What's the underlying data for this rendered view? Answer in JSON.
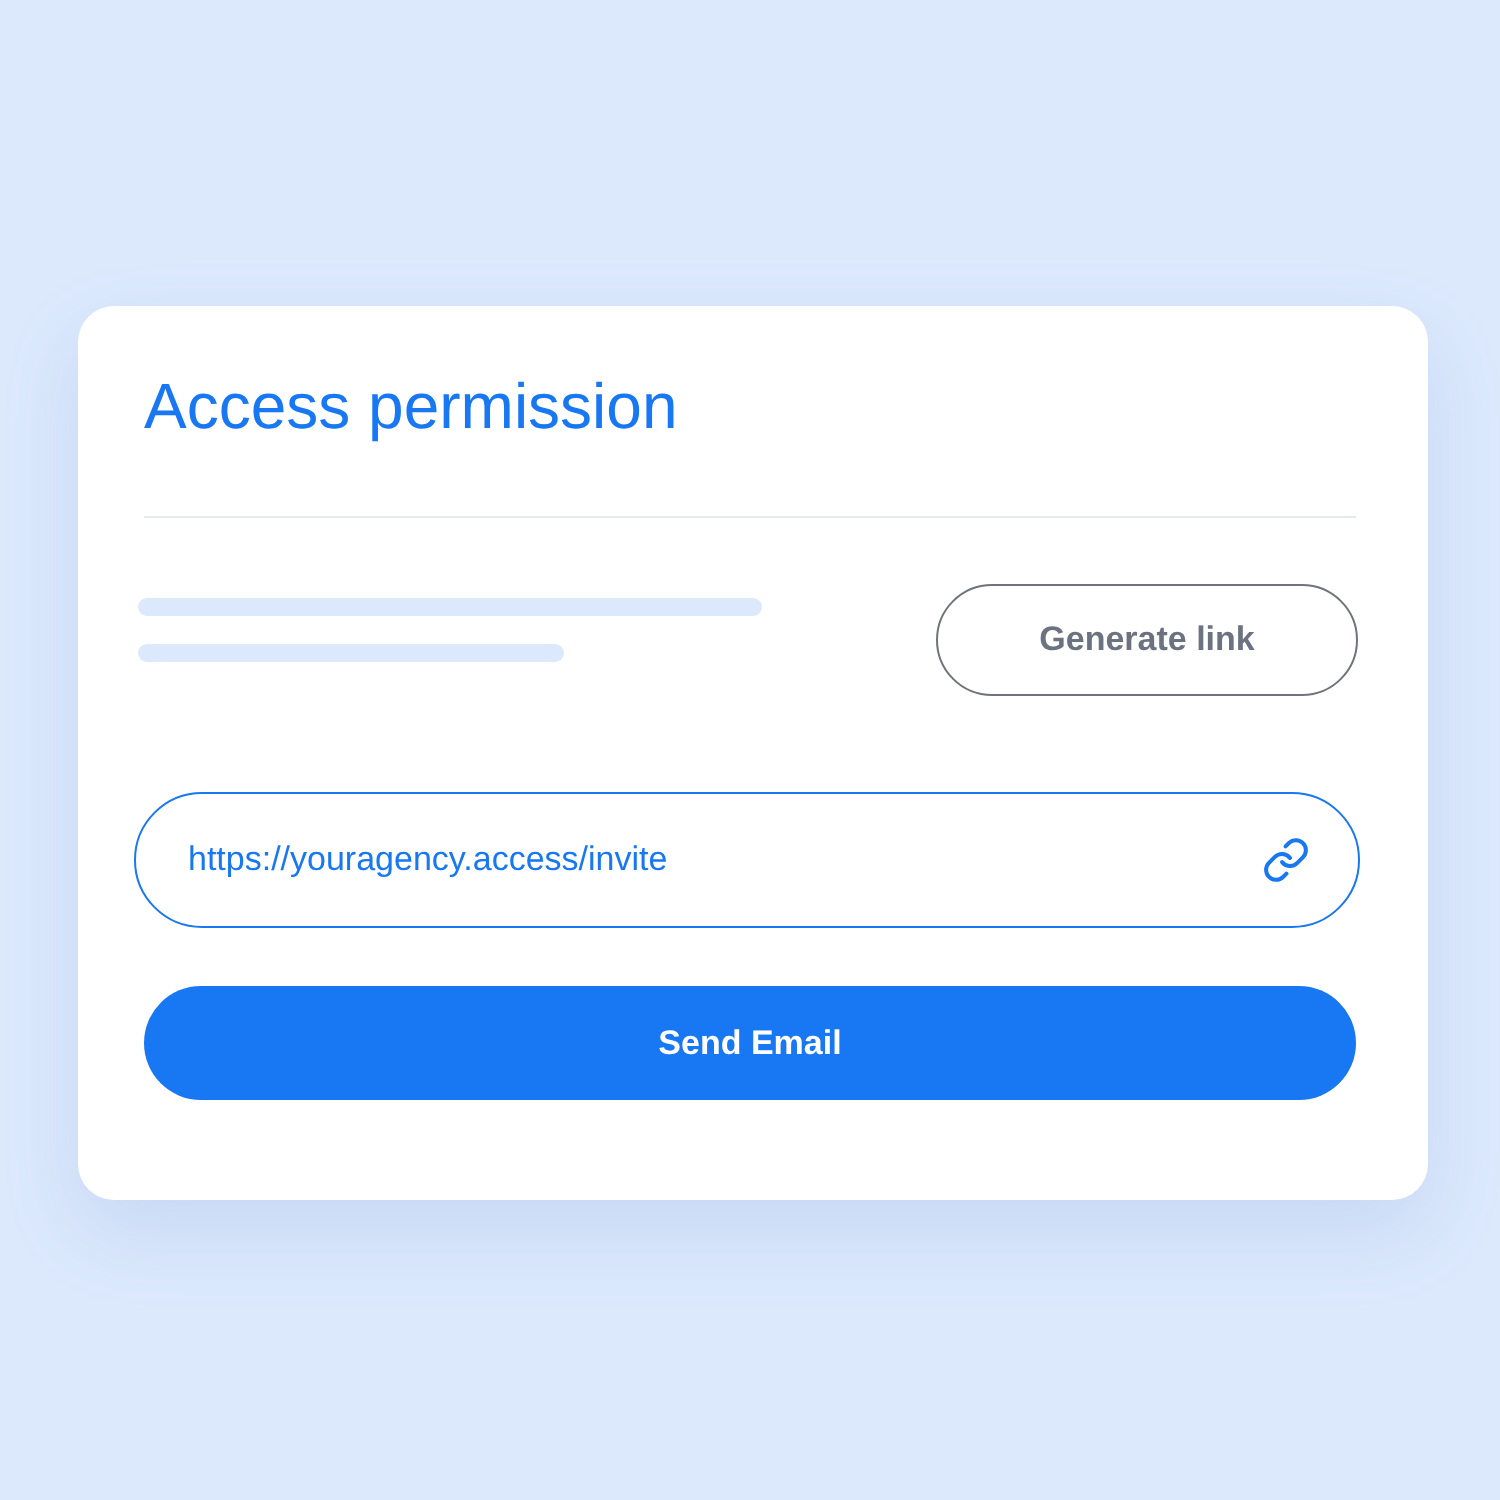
{
  "card": {
    "title": "Access permission"
  },
  "generate_button": {
    "label": "Generate link"
  },
  "link_field": {
    "value": "https://youragency.access/invite"
  },
  "send_button": {
    "label": "Send Email"
  }
}
